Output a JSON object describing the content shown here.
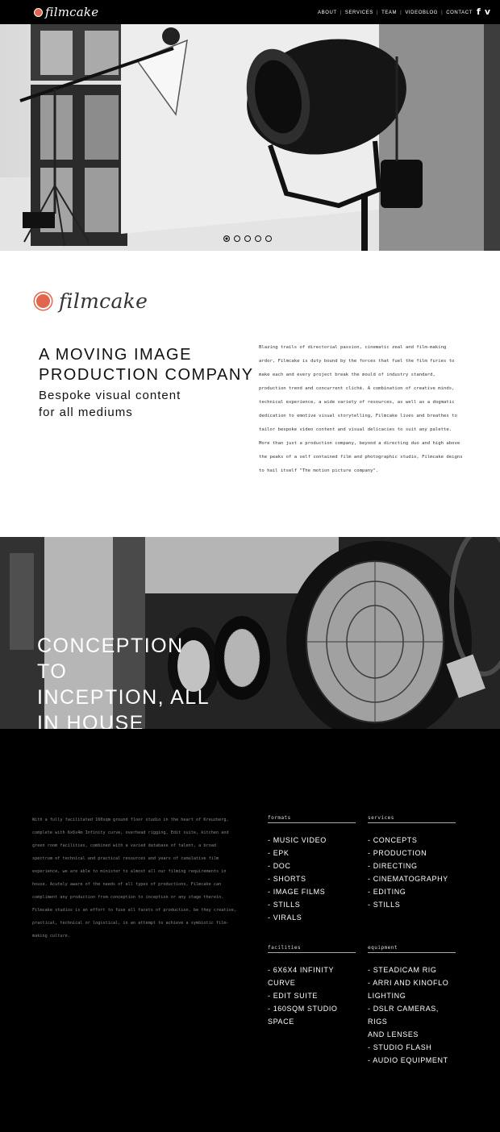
{
  "brand": {
    "name": "filmcake",
    "accent": "#e2664e"
  },
  "nav": {
    "items": [
      "ABOUT",
      "SERVICES",
      "TEAM",
      "VIDEOBLOG",
      "CONTACT"
    ],
    "social": {
      "facebook": "f",
      "vimeo": "v"
    }
  },
  "hero": {
    "slides": 5,
    "active_slide": 1
  },
  "intro": {
    "headline_line1": "A MOVING IMAGE",
    "headline_line2": "PRODUCTION COMPANY",
    "sub_line1": "Bespoke visual content",
    "sub_line2": "for all mediums",
    "body": "Blazing trails of directorial passion, cinematic zeal and film-making ardor, Filmcake is duty bound by the forces that fuel the film furies to make each and every project break the mould of industry standard, production trend and concurrent cliché. A combination of creative minds, technical experience, a wide variety of resources, as well as a dogmatic dedication to emotive visual storytelling, Filmcake lives and breathes to tailor bespoke video content and visual delicacies to suit any palette. More than just a production company, beyond a directing duo and high above the peaks of a self contained film and photographic studio, Filmcake deigns to hail itself \"The motion picture company\"."
  },
  "feature": {
    "line1": "CONCEPTION TO",
    "line2": "INCEPTION, ALL",
    "line3": "IN HOUSE"
  },
  "studio": {
    "text": "With a fully facilitated 160sqm ground floor studio in the heart of Kreuzberg, complete with 6x6x4m Infinity curve, overhead rigging, Edit suite, kitchen and green room facilities, combined with a varied database of talent, a broad spectrum of technical and practical resources and years of cumulative film experience, we are able to minister to almost all our filming requirements in house. Acutely aware of the needs of all types of productions, Filmcake can compliment any production from conception to inception or any stage therein. Filmcake studios is an effort to fuse all facets of production, be they creative, practical, technical or logistical, in an attempt to achieve a symbiotic film-making culture."
  },
  "columns": {
    "formats": {
      "title": "formats",
      "items": [
        "- MUSIC VIDEO",
        "- EPK",
        "- DOC",
        "- SHORTS",
        "- IMAGE FILMS",
        "- STILLS",
        "- VIRALS"
      ]
    },
    "services": {
      "title": "services",
      "items": [
        "- CONCEPTS",
        "- PRODUCTION",
        "- DIRECTING",
        "- CINEMATOGRAPHY",
        "- EDITING",
        "- STILLS"
      ]
    },
    "facilities": {
      "title": "facilities",
      "items": [
        "- 6X6X4 INFINITY CURVE",
        "- EDIT SUITE",
        "- 160SQM STUDIO SPACE"
      ]
    },
    "equipment": {
      "title": "equipment",
      "items": [
        "- STEADICAM RIG",
        "- ARRI AND KINOFLO",
        "LIGHTING",
        "- DSLR CAMERAS, RIGS",
        "AND LENSES",
        "- STUDIO FLASH",
        "- AUDIO EQUIPMENT"
      ]
    }
  }
}
